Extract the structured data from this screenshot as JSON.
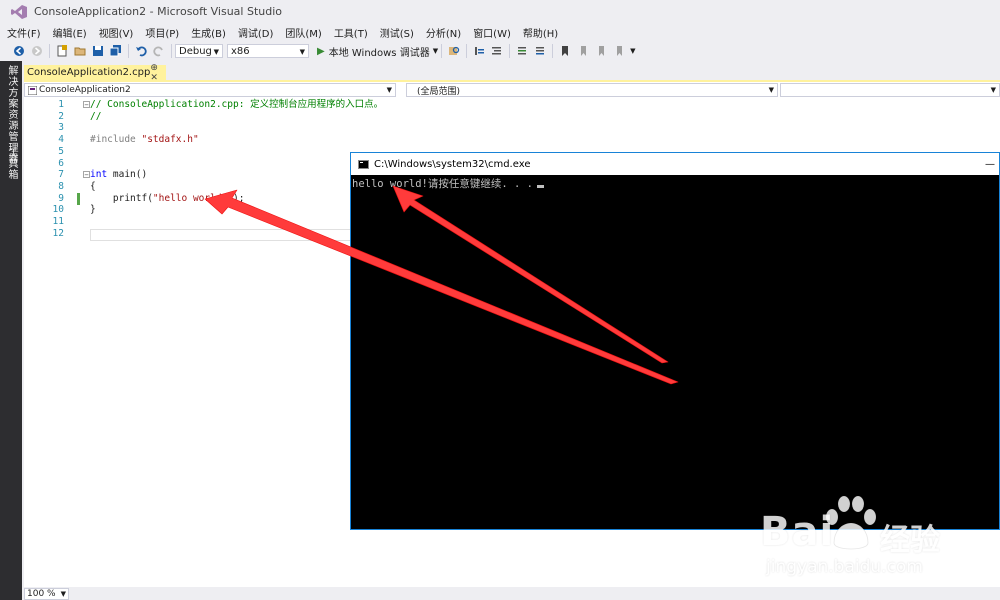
{
  "window": {
    "title": "ConsoleApplication2 - Microsoft Visual Studio"
  },
  "menu": [
    "文件(F)",
    "编辑(E)",
    "视图(V)",
    "项目(P)",
    "生成(B)",
    "调试(D)",
    "团队(M)",
    "工具(T)",
    "测试(S)",
    "分析(N)",
    "窗口(W)",
    "帮助(H)"
  ],
  "toolbar": {
    "config": "Debug",
    "platform": "x86",
    "run_label": "本地 Windows 调试器"
  },
  "sidebar": {
    "tabs": [
      "解决方案资源管理器",
      "工具箱"
    ]
  },
  "document": {
    "tab_label": "ConsoleApplication2.cpp",
    "tab_icons": "⊕ ✕",
    "nav_project": "ConsoleApplication2",
    "nav_scope": "(全局范围)"
  },
  "code": {
    "lines": [
      {
        "n": "1",
        "parts": [
          {
            "t": "// ConsoleApplication2.cpp: 定义控制台应用程序的入口点。",
            "c": "c-comment"
          }
        ]
      },
      {
        "n": "2",
        "parts": [
          {
            "t": "//",
            "c": "c-comment"
          }
        ]
      },
      {
        "n": "3",
        "parts": []
      },
      {
        "n": "4",
        "parts": [
          {
            "t": "#include ",
            "c": "c-pp"
          },
          {
            "t": "\"stdafx.h\"",
            "c": "c-str"
          }
        ]
      },
      {
        "n": "5",
        "parts": []
      },
      {
        "n": "6",
        "parts": []
      },
      {
        "n": "7",
        "parts": [
          {
            "t": "int",
            "c": "c-kw"
          },
          {
            "t": " main()",
            "c": ""
          }
        ]
      },
      {
        "n": "8",
        "parts": [
          {
            "t": "{",
            "c": ""
          }
        ]
      },
      {
        "n": "9",
        "parts": [
          {
            "t": "    printf(",
            "c": ""
          },
          {
            "t": "\"hello world!\"",
            "c": "c-str"
          },
          {
            "t": ");",
            "c": ""
          }
        ]
      },
      {
        "n": "10",
        "parts": [
          {
            "t": "}",
            "c": ""
          }
        ]
      },
      {
        "n": "11",
        "parts": []
      },
      {
        "n": "12",
        "parts": []
      }
    ]
  },
  "status": {
    "zoom": "100 %"
  },
  "console": {
    "title": "C:\\Windows\\system32\\cmd.exe",
    "minimize": "—",
    "output": "hello world!请按任意键继续. . ."
  },
  "watermark": {
    "brand": "Bai",
    "cn": "经验",
    "url": "jingyan.baidu.com"
  },
  "colors": {
    "accent": "#1883d7",
    "tab_active": "#fff29d",
    "sidebar": "#2d2d30",
    "arrow": "#ff3b3b"
  }
}
